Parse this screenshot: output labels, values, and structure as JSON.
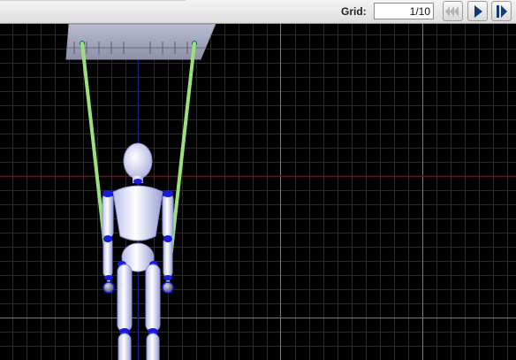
{
  "toolbar": {
    "grid_label": "Grid:",
    "grid_value": "1/10",
    "buttons": [
      {
        "name": "rewind",
        "icon": "rewind-icon"
      },
      {
        "name": "play",
        "icon": "play-icon"
      },
      {
        "name": "step-forward",
        "icon": "step-forward-icon"
      }
    ]
  },
  "colors": {
    "background": "#000000",
    "grid_minor": "#2a2a2a",
    "grid_major": "#7a7a7a",
    "x_axis": "#7a1010",
    "y_axis": "#1a1a8a",
    "strings": "#9be07a",
    "joints": "#1a1ae0",
    "figure": "#e6e8ff"
  }
}
